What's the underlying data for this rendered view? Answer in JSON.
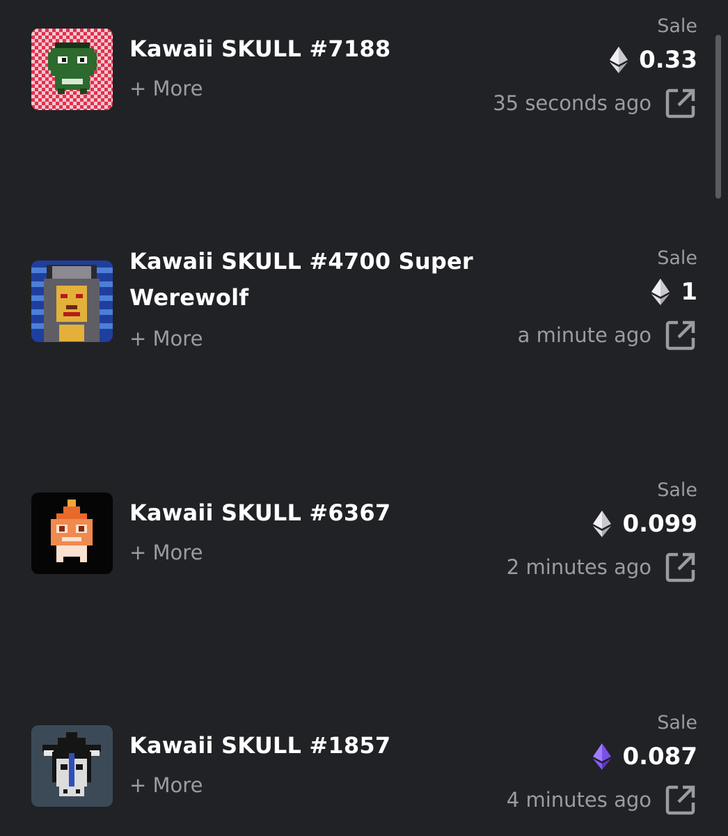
{
  "items": [
    {
      "title": "Kawaii SKULL #7188",
      "more": "+ More",
      "event": "Sale",
      "price": "0.33",
      "eth_color": "#c9c9cf",
      "time": "35 seconds ago",
      "image_icon": "green-skull-pixel-art"
    },
    {
      "title": "Kawaii SKULL #4700 Super Werewolf",
      "more": "+ More",
      "event": "Sale",
      "price": "1",
      "eth_color": "#c9c9cf",
      "time": "a minute ago",
      "image_icon": "werewolf-skull-pixel-art"
    },
    {
      "title": "Kawaii SKULL #6367",
      "more": "+ More",
      "event": "Sale",
      "price": "0.099",
      "eth_color": "#c9c9cf",
      "time": "2 minutes ago",
      "image_icon": "orange-skull-pixel-art"
    },
    {
      "title": "Kawaii SKULL #1857",
      "more": "+ More",
      "event": "Sale",
      "price": "0.087",
      "eth_color": "#8a5cf5",
      "time": "4 minutes ago",
      "image_icon": "hat-skull-pixel-art"
    }
  ],
  "icons": {
    "currency": "ethereum-icon",
    "external_link": "external-link-icon"
  }
}
